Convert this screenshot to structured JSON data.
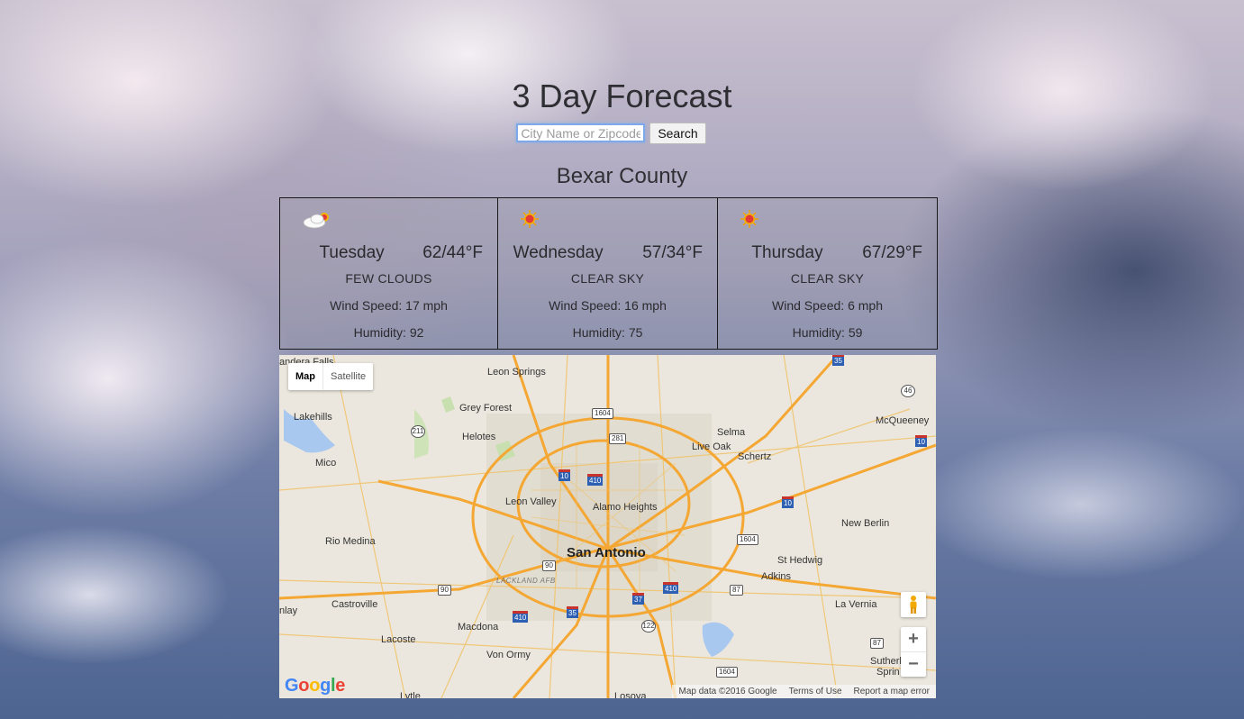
{
  "header": {
    "title": "3 Day Forecast"
  },
  "search": {
    "placeholder": "City Name or Zipcode",
    "value": "",
    "button_label": "Search"
  },
  "location": {
    "name": "Bexar County"
  },
  "forecast": [
    {
      "icon": "few-clouds-icon",
      "day": "Tuesday",
      "temp": "62/44°F",
      "description": "FEW CLOUDS",
      "wind": "Wind Speed: 17 mph",
      "humidity": "Humidity: 92"
    },
    {
      "icon": "sun-icon",
      "day": "Wednesday",
      "temp": "57/34°F",
      "description": "CLEAR SKY",
      "wind": "Wind Speed: 16 mph",
      "humidity": "Humidity: 75"
    },
    {
      "icon": "sun-icon",
      "day": "Thursday",
      "temp": "67/29°F",
      "description": "CLEAR SKY",
      "wind": "Wind Speed: 6 mph",
      "humidity": "Humidity: 59"
    }
  ],
  "map": {
    "type_buttons": {
      "map": "Map",
      "satellite": "Satellite",
      "selected": "Map"
    },
    "zoom_in": "+",
    "zoom_out": "−",
    "logo": "Google",
    "attribution": {
      "data": "Map data ©2016 Google",
      "terms": "Terms of Use",
      "report": "Report a map error"
    },
    "places": {
      "bandera_falls": "andera Falls",
      "leon_springs": "Leon Springs",
      "lakehills": "Lakehills",
      "grey_forest": "Grey Forest",
      "helotes": "Helotes",
      "selma": "Selma",
      "mcqueeney": "McQueeney",
      "live_oak": "Live Oak",
      "schertz": "Schertz",
      "mico": "Mico",
      "leon_valley": "Leon Valley",
      "alamo_heights": "Alamo Heights",
      "new_berlin": "New Berlin",
      "rio_medina": "Rio Medina",
      "san_antonio": "San Antonio",
      "st_hedwig": "St Hedwig",
      "lackland": "LACKLAND AFB",
      "adkins": "Adkins",
      "castroville": "Castroville",
      "la_vernia": "La Vernia",
      "inlay": "nlay",
      "macdona": "Macdona",
      "lacoste": "Lacoste",
      "von_ormy": "Von Ormy",
      "sutherland": "Sutherl",
      "springs": "Sprin",
      "lytle": "Lytle",
      "losoya": "Losoya"
    },
    "shields": {
      "i35_n": "35",
      "s46": "46",
      "s1604_n": "1604",
      "s281": "281",
      "s211": "211",
      "i10_ne": "10",
      "i10_w": "10",
      "i410_n": "410",
      "i10_e": "10",
      "s1604_e": "1604",
      "s90": "90",
      "us90": "90",
      "s87": "87",
      "i410_e": "410",
      "i37": "37",
      "i410_sw": "410",
      "i35_s": "35",
      "s122": "122",
      "s87_s": "87",
      "s1604_s": "1604"
    }
  }
}
